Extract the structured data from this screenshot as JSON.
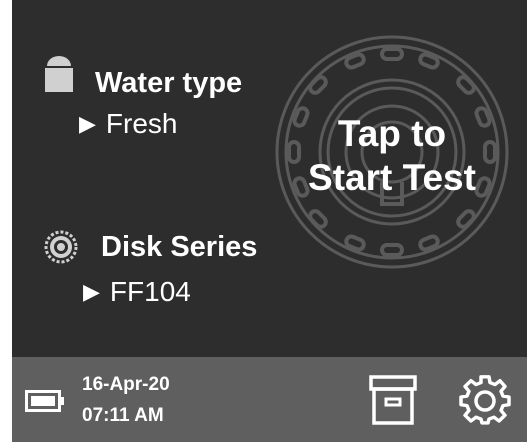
{
  "water": {
    "title": "Water type",
    "value": "Fresh",
    "icon": "water-bucket-icon"
  },
  "disk": {
    "title": "Disk Series",
    "value": "FF104",
    "icon": "disk-icon"
  },
  "start": {
    "line1": "Tap to",
    "line2": "Start Test",
    "icon": "disk-outline-icon"
  },
  "status": {
    "date": "16-Apr-20",
    "time": "07:11 AM",
    "battery_icon": "battery-icon",
    "archive_icon": "archive-icon",
    "settings_icon": "gear-icon"
  },
  "colors": {
    "screen_bg": "#2d2d2d",
    "status_bar_bg": "#5f5f5f",
    "text": "#ffffff",
    "icon_gray": "#d0d0d0"
  }
}
